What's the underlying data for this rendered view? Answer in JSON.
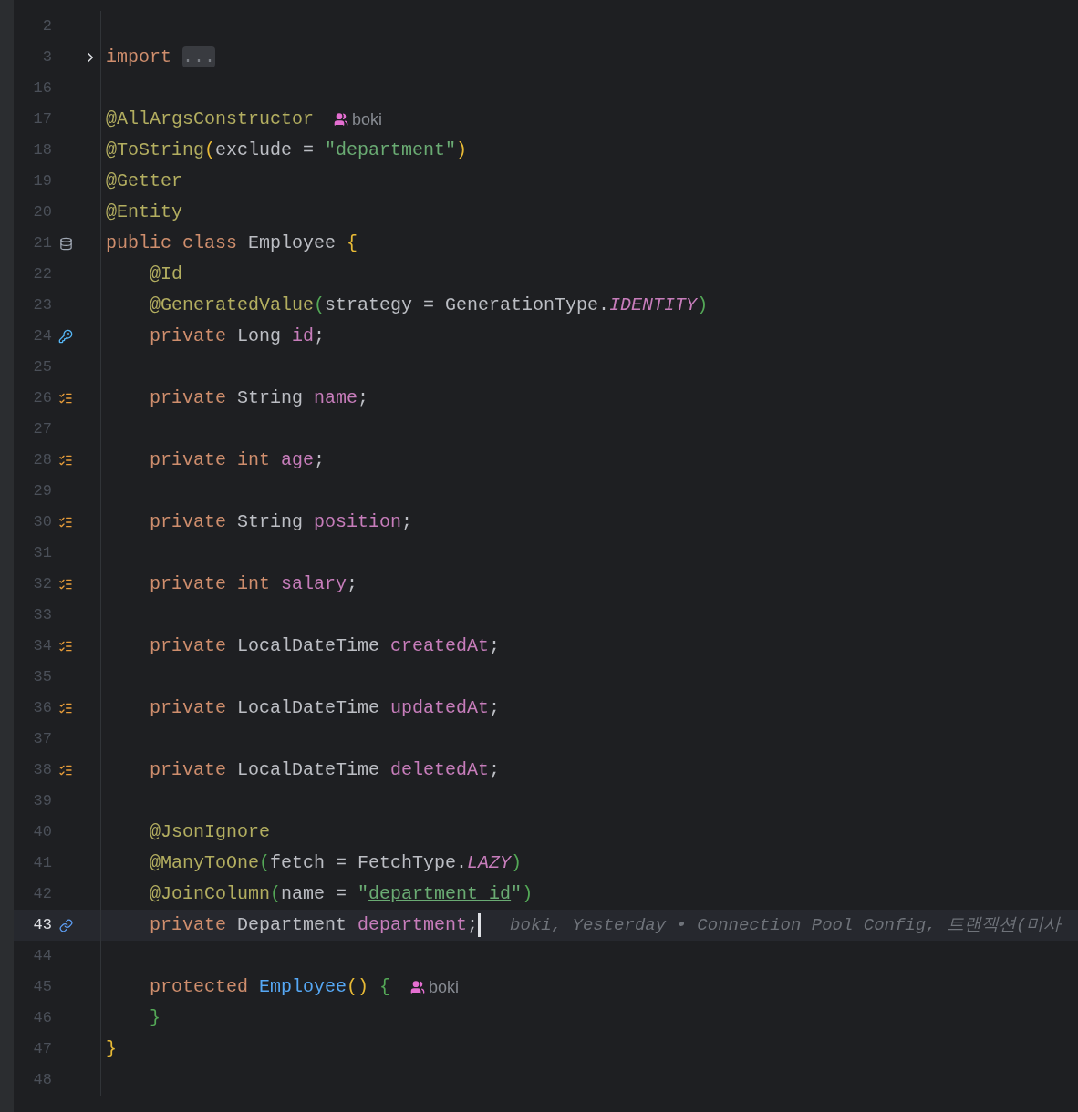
{
  "editor": {
    "lines": [
      {
        "number": "2",
        "current": false
      },
      {
        "number": "3",
        "current": false,
        "fold": {
          "expanded": false
        },
        "tokens": [
          {
            "text": "import ",
            "kind": "kw"
          },
          {
            "text": "...",
            "kind": "folded"
          }
        ]
      },
      {
        "number": "16",
        "current": false
      },
      {
        "number": "17",
        "current": false,
        "tokens": [
          {
            "text": "@AllArgsConstructor",
            "kind": "ann"
          }
        ],
        "inlay": {
          "author": "boki"
        }
      },
      {
        "number": "18",
        "current": false,
        "tokens": [
          {
            "text": "@ToString",
            "kind": "ann"
          },
          {
            "text": "(",
            "kind": "brace1"
          },
          {
            "text": "exclude = ",
            "kind": "plain"
          },
          {
            "text": "\"department\"",
            "kind": "str"
          },
          {
            "text": ")",
            "kind": "brace1"
          }
        ]
      },
      {
        "number": "19",
        "current": false,
        "tokens": [
          {
            "text": "@Getter",
            "kind": "ann"
          }
        ]
      },
      {
        "number": "20",
        "current": false,
        "tokens": [
          {
            "text": "@Entity",
            "kind": "ann"
          }
        ]
      },
      {
        "number": "21",
        "current": false,
        "gutter_icon": {
          "kind": "database"
        },
        "tokens": [
          {
            "text": "public class ",
            "kind": "kw"
          },
          {
            "text": "Employee ",
            "kind": "plain"
          },
          {
            "text": "{",
            "kind": "brace1"
          }
        ]
      },
      {
        "number": "22",
        "current": false,
        "indented": true,
        "tokens": [
          {
            "text": "@Id",
            "kind": "ann"
          }
        ]
      },
      {
        "number": "23",
        "current": false,
        "indented": true,
        "tokens": [
          {
            "text": "@GeneratedValue",
            "kind": "ann"
          },
          {
            "text": "(",
            "kind": "brace2"
          },
          {
            "text": "strategy = GenerationType.",
            "kind": "plain"
          },
          {
            "text": "IDENTITY",
            "kind": "const"
          },
          {
            "text": ")",
            "kind": "brace2"
          }
        ]
      },
      {
        "number": "24",
        "current": false,
        "indented": true,
        "gutter_icon": {
          "kind": "key"
        },
        "tokens": [
          {
            "text": "private ",
            "kind": "kw"
          },
          {
            "text": "Long ",
            "kind": "plain"
          },
          {
            "text": "id",
            "kind": "field"
          },
          {
            "text": ";",
            "kind": "plain"
          }
        ]
      },
      {
        "number": "25",
        "current": false
      },
      {
        "number": "26",
        "current": false,
        "indented": true,
        "gutter_icon": {
          "kind": "column"
        },
        "tokens": [
          {
            "text": "private ",
            "kind": "kw"
          },
          {
            "text": "String ",
            "kind": "plain"
          },
          {
            "text": "name",
            "kind": "field"
          },
          {
            "text": ";",
            "kind": "plain"
          }
        ]
      },
      {
        "number": "27",
        "current": false
      },
      {
        "number": "28",
        "current": false,
        "indented": true,
        "gutter_icon": {
          "kind": "column"
        },
        "tokens": [
          {
            "text": "private int ",
            "kind": "kw"
          },
          {
            "text": "age",
            "kind": "field"
          },
          {
            "text": ";",
            "kind": "plain"
          }
        ]
      },
      {
        "number": "29",
        "current": false
      },
      {
        "number": "30",
        "current": false,
        "indented": true,
        "gutter_icon": {
          "kind": "column"
        },
        "tokens": [
          {
            "text": "private ",
            "kind": "kw"
          },
          {
            "text": "String ",
            "kind": "plain"
          },
          {
            "text": "position",
            "kind": "field"
          },
          {
            "text": ";",
            "kind": "plain"
          }
        ]
      },
      {
        "number": "31",
        "current": false
      },
      {
        "number": "32",
        "current": false,
        "indented": true,
        "gutter_icon": {
          "kind": "column"
        },
        "tokens": [
          {
            "text": "private int ",
            "kind": "kw"
          },
          {
            "text": "salary",
            "kind": "field"
          },
          {
            "text": ";",
            "kind": "plain"
          }
        ]
      },
      {
        "number": "33",
        "current": false
      },
      {
        "number": "34",
        "current": false,
        "indented": true,
        "gutter_icon": {
          "kind": "column"
        },
        "tokens": [
          {
            "text": "private ",
            "kind": "kw"
          },
          {
            "text": "LocalDateTime ",
            "kind": "plain"
          },
          {
            "text": "createdAt",
            "kind": "field"
          },
          {
            "text": ";",
            "kind": "plain"
          }
        ]
      },
      {
        "number": "35",
        "current": false
      },
      {
        "number": "36",
        "current": false,
        "indented": true,
        "gutter_icon": {
          "kind": "column"
        },
        "tokens": [
          {
            "text": "private ",
            "kind": "kw"
          },
          {
            "text": "LocalDateTime ",
            "kind": "plain"
          },
          {
            "text": "updatedAt",
            "kind": "field"
          },
          {
            "text": ";",
            "kind": "plain"
          }
        ]
      },
      {
        "number": "37",
        "current": false
      },
      {
        "number": "38",
        "current": false,
        "indented": true,
        "gutter_icon": {
          "kind": "column"
        },
        "tokens": [
          {
            "text": "private ",
            "kind": "kw"
          },
          {
            "text": "LocalDateTime ",
            "kind": "plain"
          },
          {
            "text": "deletedAt",
            "kind": "field"
          },
          {
            "text": ";",
            "kind": "plain"
          }
        ]
      },
      {
        "number": "39",
        "current": false
      },
      {
        "number": "40",
        "current": false,
        "indented": true,
        "tokens": [
          {
            "text": "@JsonIgnore",
            "kind": "ann"
          }
        ]
      },
      {
        "number": "41",
        "current": false,
        "indented": true,
        "tokens": [
          {
            "text": "@ManyToOne",
            "kind": "ann"
          },
          {
            "text": "(",
            "kind": "brace2"
          },
          {
            "text": "fetch = FetchType.",
            "kind": "plain"
          },
          {
            "text": "LAZY",
            "kind": "const"
          },
          {
            "text": ")",
            "kind": "brace2"
          }
        ]
      },
      {
        "number": "42",
        "current": false,
        "indented": true,
        "tokens": [
          {
            "text": "@JoinColumn",
            "kind": "ann"
          },
          {
            "text": "(",
            "kind": "brace2"
          },
          {
            "text": "name = ",
            "kind": "plain"
          },
          {
            "text": "\"",
            "kind": "str"
          },
          {
            "text": "department_id",
            "kind": "strlink"
          },
          {
            "text": "\"",
            "kind": "str"
          },
          {
            "text": ")",
            "kind": "brace2"
          }
        ]
      },
      {
        "number": "43",
        "current": true,
        "indented": true,
        "gutter_icon": {
          "kind": "link"
        },
        "tokens": [
          {
            "text": "private ",
            "kind": "kw"
          },
          {
            "text": "Department ",
            "kind": "plain"
          },
          {
            "text": "department",
            "kind": "field"
          },
          {
            "text": ";",
            "kind": "plain"
          }
        ],
        "blame": "boki, Yesterday • Connection Pool Config, 트랜잭션(미사"
      },
      {
        "number": "44",
        "current": false
      },
      {
        "number": "45",
        "current": false,
        "indented": true,
        "tokens": [
          {
            "text": "protected ",
            "kind": "kw"
          },
          {
            "text": "Employee",
            "kind": "method"
          },
          {
            "text": "()",
            "kind": "brace1"
          },
          {
            "text": " {",
            "kind": "brace2"
          }
        ],
        "inlay": {
          "author": "boki"
        }
      },
      {
        "number": "46",
        "current": false,
        "indented": true,
        "tokens": [
          {
            "text": "}",
            "kind": "brace2"
          }
        ]
      },
      {
        "number": "47",
        "current": false,
        "tokens": [
          {
            "text": "}",
            "kind": "brace1"
          }
        ]
      },
      {
        "number": "48",
        "current": false
      }
    ]
  }
}
